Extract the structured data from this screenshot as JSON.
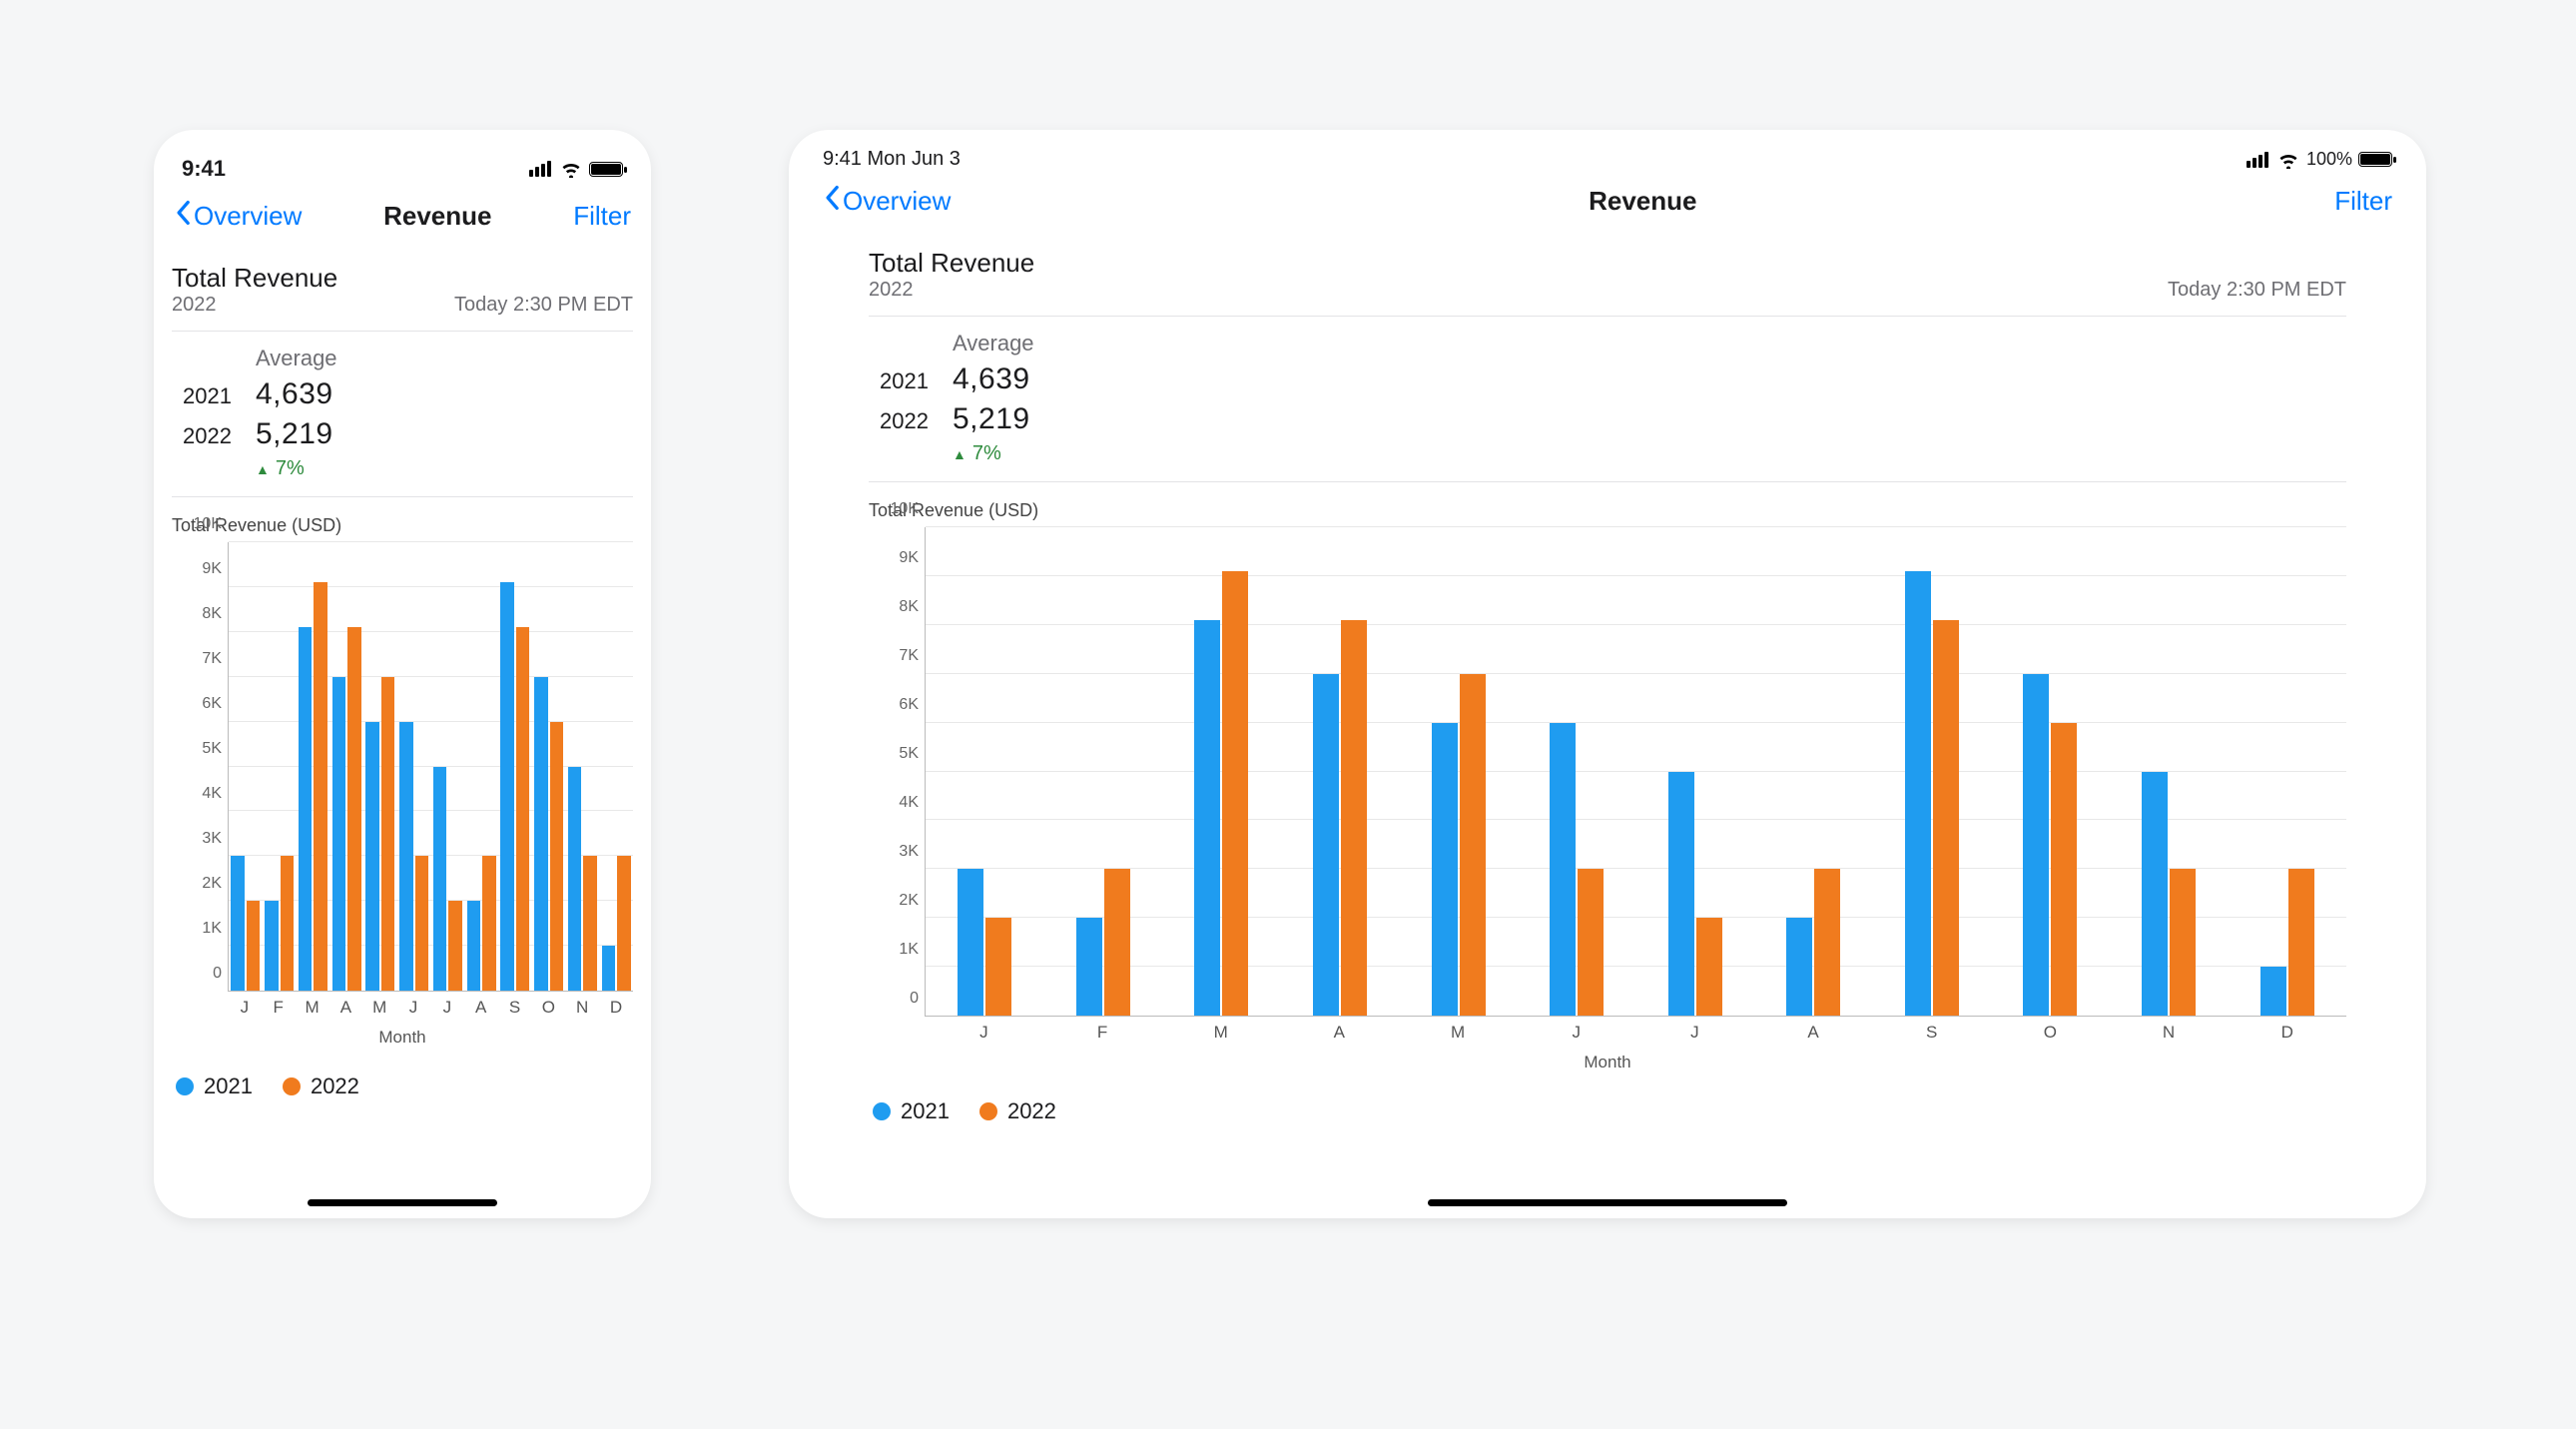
{
  "status": {
    "phone_time": "9:41",
    "tablet_time_date": "9:41 Mon Jun 3",
    "battery_pct_label": "100%"
  },
  "nav": {
    "back_label": "Overview",
    "title": "Revenue",
    "action_label": "Filter"
  },
  "header": {
    "title": "Total Revenue",
    "subtitle_year": "2022",
    "timestamp": "Today 2:30 PM EDT"
  },
  "averages": {
    "heading": "Average",
    "rows": [
      {
        "year": "2021",
        "value": "4,639"
      },
      {
        "year": "2022",
        "value": "5,219"
      }
    ],
    "delta_label": "7%"
  },
  "chart_caption": "Total Revenue (USD)",
  "x_label": "Month",
  "legend": [
    {
      "label": "2021",
      "color": "#1f9cf0"
    },
    {
      "label": "2022",
      "color": "#f07b1e"
    }
  ],
  "chart_data": {
    "type": "bar",
    "title": "Total Revenue (USD)",
    "xlabel": "Month",
    "ylabel": "",
    "ylim": [
      0,
      10000
    ],
    "y_ticks": [
      "0",
      "1K",
      "2K",
      "3K",
      "4K",
      "5K",
      "6K",
      "7K",
      "8K",
      "9K",
      "10K"
    ],
    "categories": [
      "J",
      "F",
      "M",
      "A",
      "M",
      "J",
      "J",
      "A",
      "S",
      "O",
      "N",
      "D"
    ],
    "series": [
      {
        "name": "2021",
        "color": "#1f9cf0",
        "values": [
          3000,
          2000,
          8100,
          7000,
          6000,
          6000,
          5000,
          2000,
          9100,
          7000,
          5000,
          1000
        ]
      },
      {
        "name": "2022",
        "color": "#f07b1e",
        "values": [
          2000,
          3000,
          9100,
          8100,
          7000,
          3000,
          2000,
          3000,
          8100,
          6000,
          3000,
          3000
        ]
      }
    ]
  }
}
